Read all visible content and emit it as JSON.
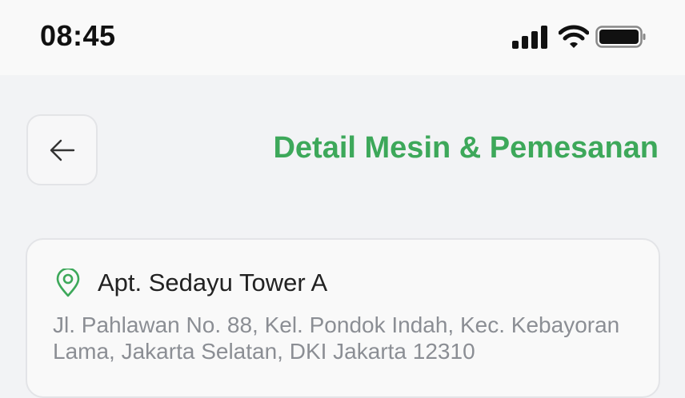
{
  "status_bar": {
    "time": "08:45",
    "icons": [
      "signal-icon",
      "wifi-icon",
      "battery-icon"
    ]
  },
  "header": {
    "back_icon": "arrow-left-icon",
    "title": "Detail Mesin & Pemesanan"
  },
  "location": {
    "icon": "map-pin-icon",
    "name": "Apt. Sedayu Tower A",
    "address": "Jl. Pahlawan No. 88, Kel. Pondok Indah, Kec. Kebayoran Lama, Jakarta Selatan, DKI Jakarta 12310"
  },
  "colors": {
    "accent": "#3da85a",
    "background": "#f2f3f5",
    "muted_text": "#8b8e94"
  }
}
